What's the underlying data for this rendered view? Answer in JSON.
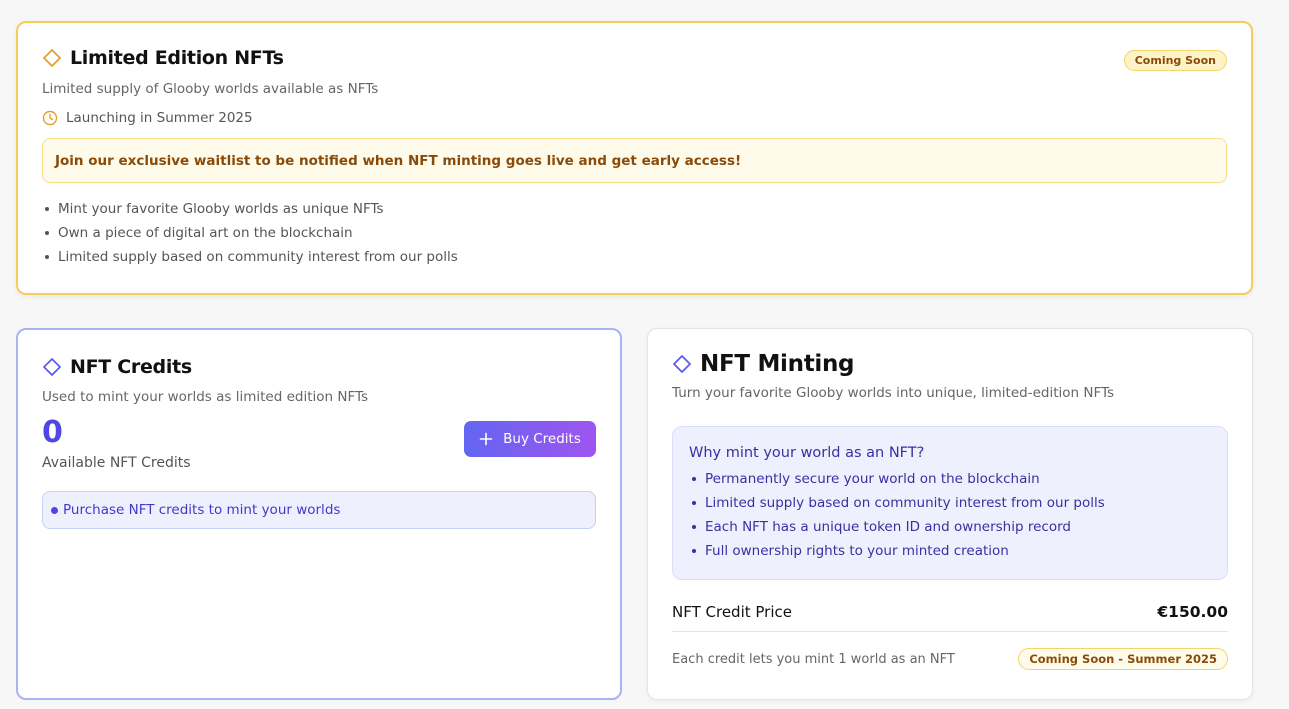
{
  "limited": {
    "title": "Limited Edition NFTs",
    "badge": "Coming Soon",
    "subtitle": "Limited supply of Glooby worlds available as NFTs",
    "launch": "Launching in Summer 2025",
    "waitlist": "Join our exclusive waitlist to be notified when NFT minting goes live and get early access!",
    "bullets": [
      "Mint your favorite Glooby worlds as unique NFTs",
      "Own a piece of digital art on the blockchain",
      "Limited supply based on community interest from our polls"
    ]
  },
  "credits": {
    "title": "NFT Credits",
    "subtitle": "Used to mint your worlds as limited edition NFTs",
    "count": "0",
    "count_label": "Available NFT Credits",
    "buy_label": "Buy Credits",
    "info": "Purchase NFT credits to mint your worlds"
  },
  "minting": {
    "title": "NFT Minting",
    "subtitle": "Turn your favorite Glooby worlds into unique, limited-edition NFTs",
    "why_title": "Why mint your world as an NFT?",
    "why_items": [
      "Permanently secure your world on the blockchain",
      "Limited supply based on community interest from our polls",
      "Each NFT has a unique token ID and ownership record",
      "Full ownership rights to your minted creation"
    ],
    "price_label": "NFT Credit Price",
    "price_value": "€150.00",
    "footer_text": "Each credit lets you mint 1 world as an NFT",
    "footer_badge": "Coming Soon - Summer 2025"
  },
  "colors": {
    "accent": "#4f46e5",
    "amber": "#f7cd5a",
    "amber_text": "#8a4a09"
  },
  "icons": [
    "diamond-icon",
    "clock-icon",
    "plus-icon"
  ]
}
